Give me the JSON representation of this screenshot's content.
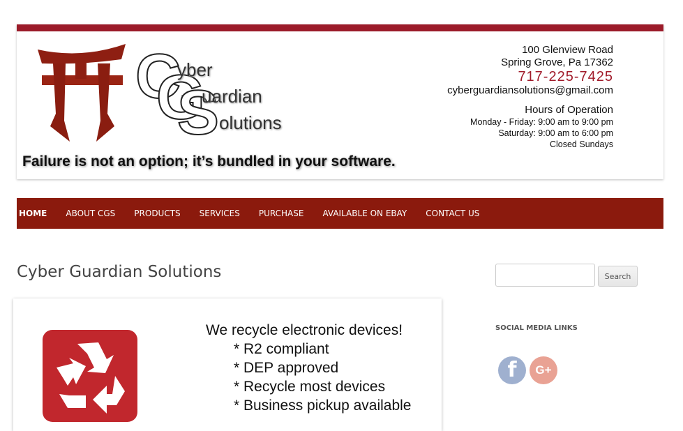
{
  "header": {
    "logo": {
      "letters": [
        "C",
        "G",
        "S"
      ],
      "words": [
        "yber",
        "uardian",
        "olutions"
      ],
      "alt": "Cyber Guardian Solutions"
    },
    "tagline": "Failure is not an option; it’s bundled in your software.",
    "address1": "100 Glenview Road",
    "address2": "Spring Grove, Pa 17362",
    "phone": "717-225-7425",
    "email": "cyberguardiansolutions@gmail.com",
    "hours_title": "Hours of Operation",
    "hours": [
      "Monday - Friday: 9:00 am to 9:00 pm",
      "Saturday: 9:00 am to 6:00 pm",
      "Closed Sundays"
    ],
    "colors": {
      "bar": "#9b1b29",
      "phone": "#a11c2b"
    }
  },
  "nav": {
    "color": "#8b1a0d",
    "items": [
      "HOME",
      "ABOUT CGS",
      "PRODUCTS",
      "SERVICES",
      "PURCHASE",
      "AVAILABLE ON EBAY",
      "CONTACT US"
    ],
    "active": "HOME"
  },
  "main": {
    "title": "Cyber Guardian Solutions",
    "banner": {
      "headline": "We recycle electronic devices!",
      "points": [
        "* R2 compliant",
        "* DEP approved",
        "* Recycle most devices",
        "* Business pickup available"
      ],
      "icon": "recycle-icon"
    }
  },
  "sidebar": {
    "search_placeholder": "",
    "search_button": "Search",
    "social_title": "SOCIAL MEDIA LINKS",
    "social": [
      {
        "icon": "facebook-icon",
        "glyph": "f"
      },
      {
        "icon": "google-plus-icon",
        "glyph": "G+"
      }
    ]
  }
}
